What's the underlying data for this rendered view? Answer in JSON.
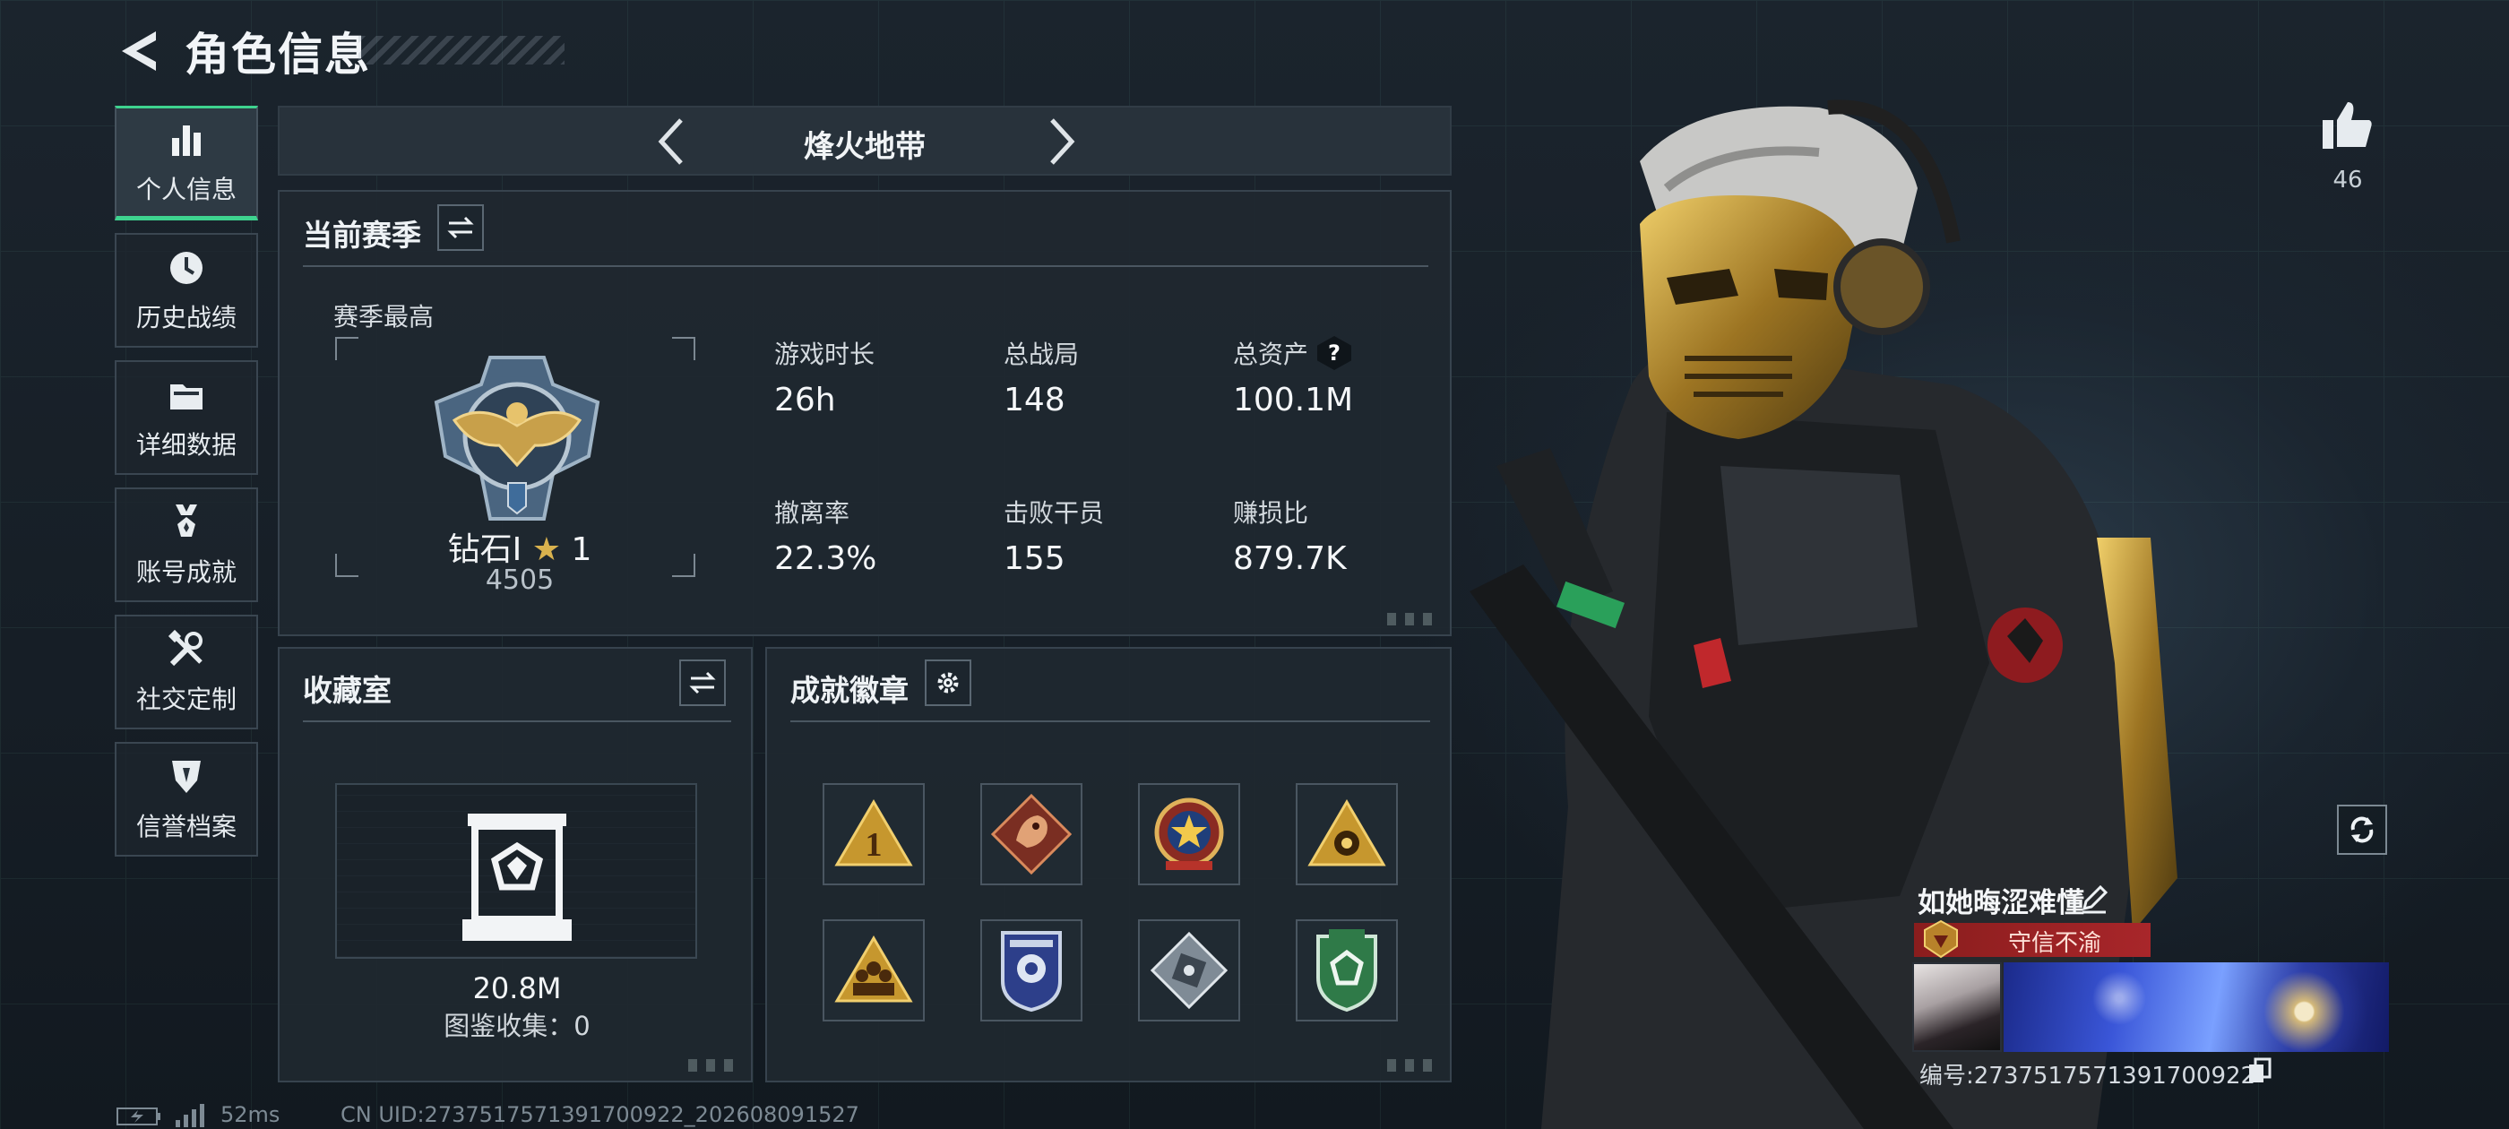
{
  "header": {
    "title": "角色信息"
  },
  "sidebar": {
    "items": [
      {
        "label": "个人信息",
        "icon": "bar-chart-icon",
        "active": true
      },
      {
        "label": "历史战绩",
        "icon": "clock-icon",
        "active": false
      },
      {
        "label": "详细数据",
        "icon": "folder-icon",
        "active": false
      },
      {
        "label": "账号成就",
        "icon": "medal-icon",
        "active": false
      },
      {
        "label": "社交定制",
        "icon": "tools-icon",
        "active": false
      },
      {
        "label": "信誉档案",
        "icon": "shield-icon",
        "active": false
      }
    ]
  },
  "mode": {
    "title": "烽火地带"
  },
  "season": {
    "title": "当前赛季",
    "best_label": "赛季最高",
    "rank_name": "钻石Ⅰ",
    "rank_stars": "1",
    "rank_score": "4505",
    "stats": [
      {
        "label": "游戏时长",
        "value": "26h"
      },
      {
        "label": "总战局",
        "value": "148"
      },
      {
        "label": "总资产",
        "value": "100.1M",
        "help": "?"
      },
      {
        "label": "撤离率",
        "value": "22.3%"
      },
      {
        "label": "击败干员",
        "value": "155"
      },
      {
        "label": "赚损比",
        "value": "879.7K"
      }
    ]
  },
  "collection": {
    "title": "收藏室",
    "value": "20.8M",
    "catalog_label": "图鉴收集：",
    "catalog_count": "0"
  },
  "badges": {
    "title": "成就徽章",
    "items": [
      "rank-one-badge-icon",
      "dragon-badge-icon",
      "star-emblem-badge-icon",
      "eye-triangle-badge-icon",
      "squad-badge-icon",
      "police-badge-icon",
      "safe-badge-icon",
      "green-shield-badge-icon"
    ]
  },
  "profile": {
    "likes": "46",
    "name": "如她晦涩难懂",
    "honor_title": "守信不渝",
    "id_label": "编号:",
    "id": "2737517571391700922"
  },
  "footer": {
    "ping": "52ms",
    "uid": "CN UID:2737517571391700922_202608091527"
  },
  "colors": {
    "accent": "#3ed38f",
    "honor": "#a8262a",
    "panel": "#1f2830"
  }
}
